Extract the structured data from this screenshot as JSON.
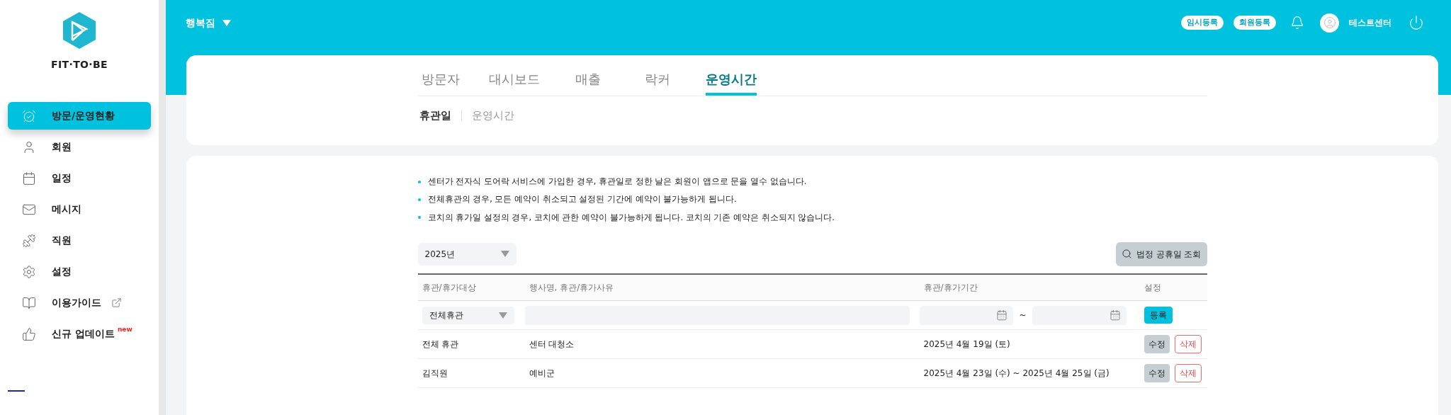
{
  "sidebar": {
    "logo_text": "FIT·TO·BE",
    "items": [
      {
        "label": "방문/운영현황",
        "selected": true
      },
      {
        "label": "회원",
        "selected": false
      },
      {
        "label": "일정",
        "selected": false
      },
      {
        "label": "메시지",
        "selected": false
      },
      {
        "label": "직원",
        "selected": false
      },
      {
        "label": "설정",
        "selected": false
      },
      {
        "label": "이용가이드",
        "selected": false,
        "external": true
      },
      {
        "label": "신규 업데이트",
        "selected": false,
        "badge": "new"
      }
    ]
  },
  "header": {
    "branch": "행복짐",
    "buttons": [
      "임시등록",
      "회원등록"
    ],
    "user": "테스트센터"
  },
  "tabs": [
    {
      "label": "방문자",
      "selected": false
    },
    {
      "label": "대시보드",
      "selected": false
    },
    {
      "label": "매출",
      "selected": false
    },
    {
      "label": "락커",
      "selected": false
    },
    {
      "label": "운영시간",
      "selected": true
    }
  ],
  "subtabs": [
    {
      "label": "휴관일",
      "selected": true
    },
    {
      "label": "운영시간",
      "selected": false
    }
  ],
  "notes": [
    "센터가 전자식 도어락 서비스에 가입한 경우, 휴관일로 정한 날은 회원이 앱으로 문을 열수 없습니다.",
    "전체휴관의 경우, 모든 예약이 취소되고 설정된 기간에 예약이 불가능하게 됩니다.",
    "코치의 휴가일 설정의 경우, 코치에 관한 예약이 불가능하게 됩니다. 코치의 기존 예약은 취소되지 않습니다."
  ],
  "year_select": {
    "value": "2025년"
  },
  "holiday_button": "법정 공휴일 조회",
  "table": {
    "columns": [
      "휴관/휴가대상",
      "행사명, 휴관/휴가사유",
      "휴관/휴가기간",
      "설정"
    ],
    "input_row": {
      "target": "전체휴관",
      "separator": "~",
      "submit": "등록"
    },
    "rows": [
      {
        "target": "전체 휴관",
        "reason": "센터 대청소",
        "period": "2025년 4월 19일 (토)",
        "actions": [
          "수정",
          "삭제"
        ]
      },
      {
        "target": "김직원",
        "reason": "예비군",
        "period": "2025년 4월 23일 (수) ~ 2025년 4월 25일 (금)",
        "actions": [
          "수정",
          "삭제"
        ]
      }
    ]
  }
}
